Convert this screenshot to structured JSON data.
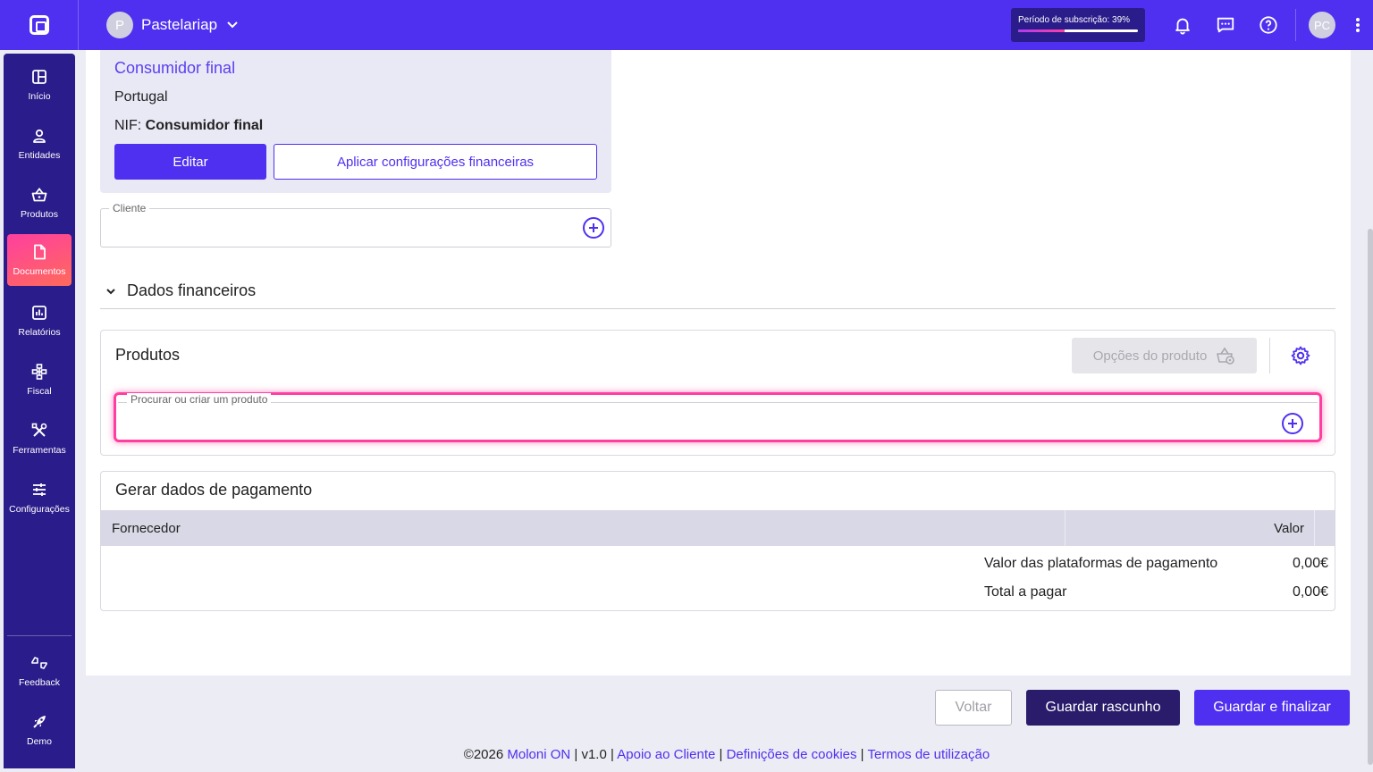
{
  "topbar": {
    "company_initial": "P",
    "company_name": "Pastelariap",
    "subscription_label": "Período de subscrição: 39%",
    "subscription_progress": 0.39,
    "user_initials": "PC",
    "icons": [
      "bell-icon",
      "chat-icon",
      "help-icon",
      "more-vertical-icon"
    ]
  },
  "sidebar": {
    "items": [
      {
        "label": "Início",
        "icon": "dashboard-icon"
      },
      {
        "label": "Entidades",
        "icon": "user-icon"
      },
      {
        "label": "Produtos",
        "icon": "basket-icon"
      },
      {
        "label": "Documentos",
        "icon": "document-icon",
        "active": true
      },
      {
        "label": "Relatórios",
        "icon": "chart-icon"
      },
      {
        "label": "Fiscal",
        "icon": "sitemap-icon"
      },
      {
        "label": "Ferramentas",
        "icon": "tools-icon"
      },
      {
        "label": "Configurações",
        "icon": "sliders-icon"
      }
    ],
    "bottom_items": [
      {
        "label": "Feedback",
        "icon": "feedback-icon"
      },
      {
        "label": "Demo",
        "icon": "rocket-icon"
      }
    ]
  },
  "client_card": {
    "name": "Consumidor final",
    "country": "Portugal",
    "nif_label": "NIF:",
    "nif_value": "Consumidor final",
    "edit_button": "Editar",
    "apply_button": "Aplicar configurações financeiras"
  },
  "client_field": {
    "legend": "Cliente",
    "value": ""
  },
  "financial_section": {
    "title": "Dados financeiros",
    "expanded": true
  },
  "products": {
    "title": "Produtos",
    "options_button": "Opções do produto",
    "search_legend": "Procurar ou criar um produto",
    "search_value": ""
  },
  "payment": {
    "title": "Gerar dados de pagamento",
    "columns": [
      "Fornecedor",
      "Valor"
    ],
    "summary": [
      {
        "label": "Valor das plataformas de pagamento",
        "value": "0,00€"
      },
      {
        "label": "Total a pagar",
        "value": "0,00€"
      }
    ]
  },
  "actions": {
    "back": "Voltar",
    "save_draft": "Guardar rascunho",
    "save_finalize": "Guardar e finalizar"
  },
  "footer": {
    "copyright": "©2026",
    "brand": "Moloni ON",
    "version": "v1.0",
    "support": "Apoio ao Cliente",
    "cookies": "Definições de cookies",
    "terms": "Termos de utilização",
    "separator": "|"
  },
  "colors": {
    "primary": "#4f30f0",
    "sidebar": "#2a1c8a",
    "accent_pink": "#ff3fa0"
  }
}
